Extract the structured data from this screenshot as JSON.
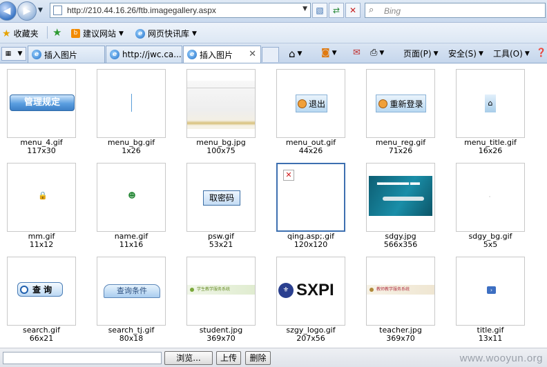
{
  "address_bar": {
    "url": "http://210.44.16.26/ftb.imagegallery.aspx",
    "search_placeholder": "Bing"
  },
  "favorites_bar": {
    "favorites_label": "收藏夹",
    "items": [
      "建议网站",
      "网页快讯库"
    ]
  },
  "tabs": [
    {
      "label": "插入图片",
      "active": false
    },
    {
      "label": "http://jwc.ca...",
      "active": false
    },
    {
      "label": "插入图片",
      "active": true
    }
  ],
  "command_bar": {
    "page": "页面(P)",
    "safety": "安全(S)",
    "tools": "工具(O)"
  },
  "gallery": {
    "rows": [
      [
        {
          "name": "menu_4.gif",
          "dim": "117x30",
          "art": "管理规定"
        },
        {
          "name": "menu_bg.gif",
          "dim": "1x26"
        },
        {
          "name": "menu_bg.jpg",
          "dim": "100x75"
        },
        {
          "name": "menu_out.gif",
          "dim": "44x26",
          "art": "退出"
        },
        {
          "name": "menu_reg.gif",
          "dim": "71x26",
          "art": "重新登录"
        },
        {
          "name": "menu_title.gif",
          "dim": "16x26"
        }
      ],
      [
        {
          "name": "mm.gif",
          "dim": "11x12"
        },
        {
          "name": "name.gif",
          "dim": "11x16"
        },
        {
          "name": "psw.gif",
          "dim": "53x21",
          "art": "取密码"
        },
        {
          "name": "qing.asp;.gif",
          "dim": "120x120",
          "selected": true
        },
        {
          "name": "sdgy.jpg",
          "dim": "566x356"
        },
        {
          "name": "sdgy_bg.gif",
          "dim": "5x5"
        }
      ],
      [
        {
          "name": "search.gif",
          "dim": "66x21",
          "art": "查 询"
        },
        {
          "name": "search_tj.gif",
          "dim": "80x18",
          "art": "查询条件"
        },
        {
          "name": "student.jpg",
          "dim": "369x70",
          "art": "学生教学服务系统"
        },
        {
          "name": "szgy_logo.gif",
          "dim": "207x56",
          "art": "SXPI"
        },
        {
          "name": "teacher.jpg",
          "dim": "369x70",
          "art": "教师教学服务系统"
        },
        {
          "name": "title.gif",
          "dim": "13x11"
        }
      ]
    ]
  },
  "upload": {
    "browse_label": "浏览...",
    "upload_label": "上传",
    "delete_label": "删除"
  },
  "watermark": "www.wooyun.org"
}
